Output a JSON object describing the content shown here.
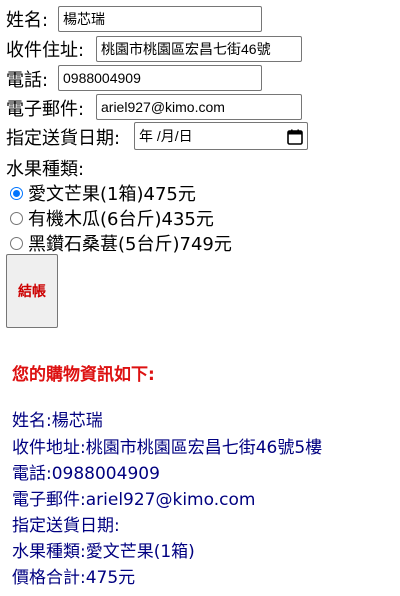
{
  "form": {
    "name_label": "姓名:",
    "name_value": "楊芯瑞",
    "address_label": "收件住址:",
    "address_value": "桃園市桃園區宏昌七街46號",
    "phone_label": "電話:",
    "phone_value": "0988004909",
    "email_label": "電子郵件:",
    "email_value": "ariel927@kimo.com",
    "date_label": "指定送貨日期:",
    "date_placeholder": "年 /月/日",
    "fruit_label": "水果種類:",
    "options": [
      {
        "label": "愛文芒果(1箱)475元",
        "checked": true
      },
      {
        "label": "有機木瓜(6台斤)435元",
        "checked": false
      },
      {
        "label": "黑鑽石桑葚(5台斤)749元",
        "checked": false
      }
    ],
    "checkout_label": "結帳"
  },
  "result": {
    "title": "您的購物資訊如下:",
    "name": "姓名:楊芯瑞",
    "address": "收件地址:桃園市桃園區宏昌七街46號5樓",
    "phone": "電話:0988004909",
    "email": "電子郵件:ariel927@kimo.com",
    "date": "指定送貨日期:",
    "fruit": "水果種類:愛文芒果(1箱)",
    "total": "價格合計:475元"
  },
  "colors": {
    "radio_accent": "#0075ff",
    "result_title": "#dd1111",
    "result_text": "#000080",
    "checkout_text": "#cc0000"
  },
  "icons": {
    "calendar": "calendar-icon"
  }
}
